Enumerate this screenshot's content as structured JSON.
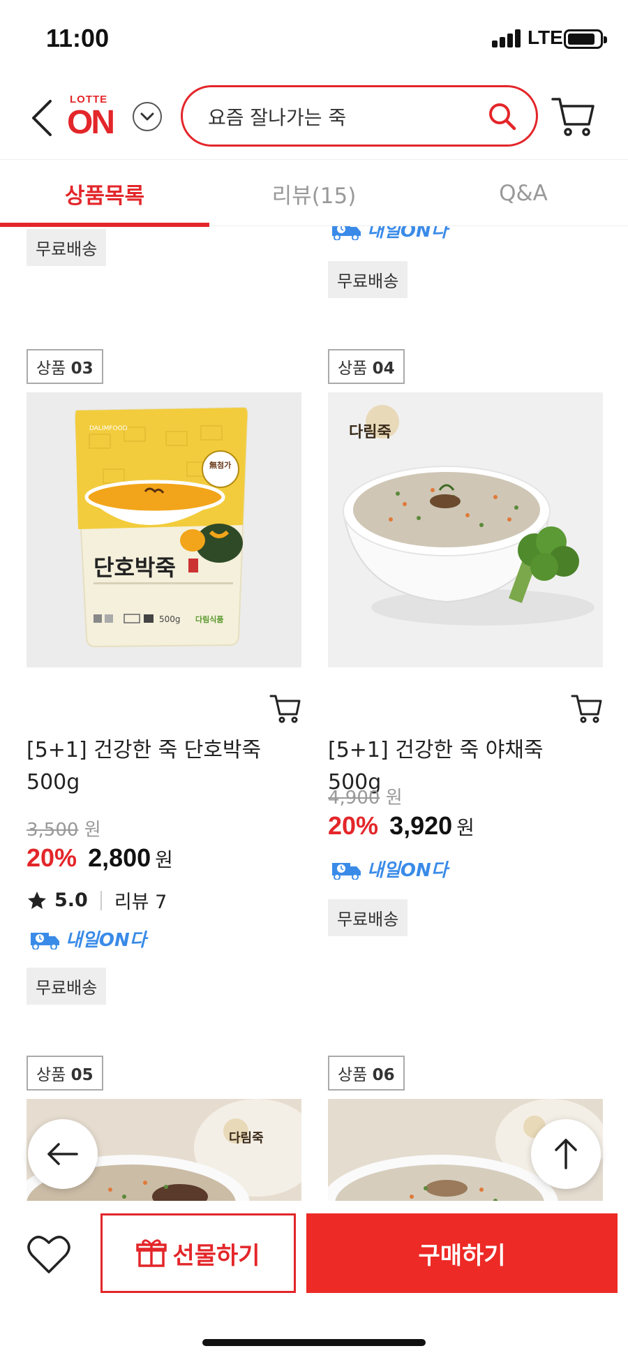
{
  "status_bar": {
    "time": "11:00",
    "network": "LTE"
  },
  "header": {
    "logo_top": "LOTTE",
    "logo_bottom": "ON",
    "search_value": "요즘 잘나가는 죽"
  },
  "tabs": [
    {
      "label": "상품목록",
      "active": true
    },
    {
      "label": "리뷰(15)",
      "active": false
    },
    {
      "label": "Q&A",
      "active": false
    }
  ],
  "labels": {
    "free_shipping": "무료배송",
    "tomorrow_delivery": "내일ON다",
    "product_prefix": "상품",
    "currency": "원"
  },
  "products": [
    {
      "number": "03",
      "title": "[5+1] 건강한 죽 단호박죽 500g",
      "original_price": "3,500",
      "discount": "20%",
      "price": "2,800",
      "rating": "5.0",
      "reviews": "리뷰 7",
      "image": "단호박죽",
      "image_brand": "DALIMFOOD",
      "image_badge": "無첨가",
      "image_weight": "500g",
      "image_maker": "다림식품"
    },
    {
      "number": "04",
      "title": "[5+1] 건강한 죽 야채죽 500g",
      "original_price": "4,900",
      "discount": "20%",
      "price": "3,920",
      "image_brand": "다림죽"
    },
    {
      "number": "05",
      "image_brand": "다림죽"
    },
    {
      "number": "06"
    }
  ],
  "bottom_bar": {
    "gift_label": "선물하기",
    "buy_label": "구매하기"
  },
  "colors": {
    "accent": "#e3262a",
    "delivery_blue": "#3a8be8"
  }
}
